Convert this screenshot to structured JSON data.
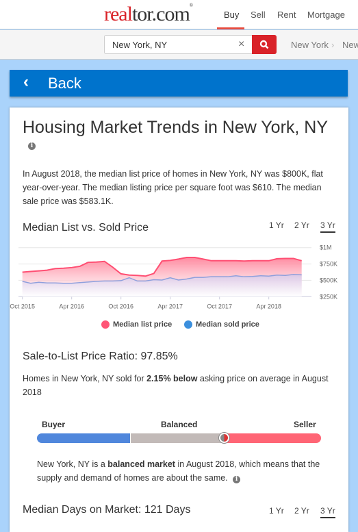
{
  "header": {
    "logo_left": "real",
    "logo_right": "tor.com",
    "logo_mark": "®",
    "nav": [
      "Buy",
      "Sell",
      "Rent",
      "Mortgage"
    ],
    "active_nav": "Buy"
  },
  "search": {
    "value": "New York, NY",
    "placeholder": "",
    "clear_icon": "close-icon",
    "button_icon": "search-icon",
    "breadcrumb": [
      "New York",
      "New"
    ]
  },
  "back": {
    "label": "Back",
    "icon": "chevron-left-icon"
  },
  "page": {
    "title": "Housing Market Trends in New York, NY",
    "summary": "In August 2018, the median list price of homes in New York, NY was $800K, flat year-over-year. The median listing price per square foot was $610. The median sale price was $583.1K.",
    "price_section": {
      "title": "Median List vs. Sold Price",
      "ranges": [
        "1 Yr",
        "2 Yr",
        "3 Yr"
      ],
      "selected": "3 Yr"
    },
    "ratio_section": {
      "title": "Sale-to-List Price Ratio: 97.85%",
      "text_before": "Homes in New York, NY sold for ",
      "text_bold": "2.15% below",
      "text_after": " asking price on average in August 2018"
    },
    "market": {
      "labels": [
        "Buyer",
        "Balanced",
        "Seller"
      ],
      "position_fraction": 0.66,
      "colors": {
        "buyer": "#5087dc",
        "balanced": "#c2bab8",
        "seller": "#ff6575"
      },
      "text_before": "New York, NY is a ",
      "text_bold": "balanced market",
      "text_after": " in August 2018, which means that the supply and demand of homes are about the same."
    },
    "days_section": {
      "title": "Median Days on Market: 121 Days",
      "ranges": [
        "1 Yr",
        "2 Yr",
        "3 Yr"
      ],
      "selected": "3 Yr"
    }
  },
  "chart_data": {
    "type": "area",
    "x_start": "Oct 2015",
    "x_end": "Aug 2018",
    "x_interval": "monthly",
    "x_tick_labels": [
      "Oct 2015",
      "Apr 2016",
      "Oct 2016",
      "Apr 2017",
      "Oct 2017",
      "Apr 2018"
    ],
    "y_tick_labels": [
      "$1M",
      "$750K",
      "$500K",
      "$250K"
    ],
    "ylim": [
      250000,
      1000000
    ],
    "y_ticks": [
      1000000,
      750000,
      500000,
      250000
    ],
    "grid": true,
    "legend_placement": "bottom",
    "series": [
      {
        "name": "Median list price",
        "color": "#ff5476",
        "values": [
          625,
          635,
          645,
          655,
          680,
          685,
          695,
          715,
          775,
          780,
          790,
          700,
          600,
          580,
          575,
          565,
          605,
          795,
          805,
          825,
          850,
          850,
          825,
          800,
          800,
          800,
          800,
          795,
          800,
          800,
          800,
          830,
          835,
          835,
          800
        ]
      },
      {
        "name": "Median sold price",
        "color": "#3b8fdd",
        "values": [
          485,
          455,
          470,
          460,
          460,
          455,
          455,
          465,
          475,
          485,
          490,
          490,
          495,
          540,
          490,
          490,
          510,
          505,
          540,
          505,
          520,
          545,
          545,
          555,
          555,
          555,
          570,
          555,
          560,
          570,
          565,
          580,
          575,
          590,
          585
        ]
      }
    ],
    "value_unit": "thousands USD"
  }
}
